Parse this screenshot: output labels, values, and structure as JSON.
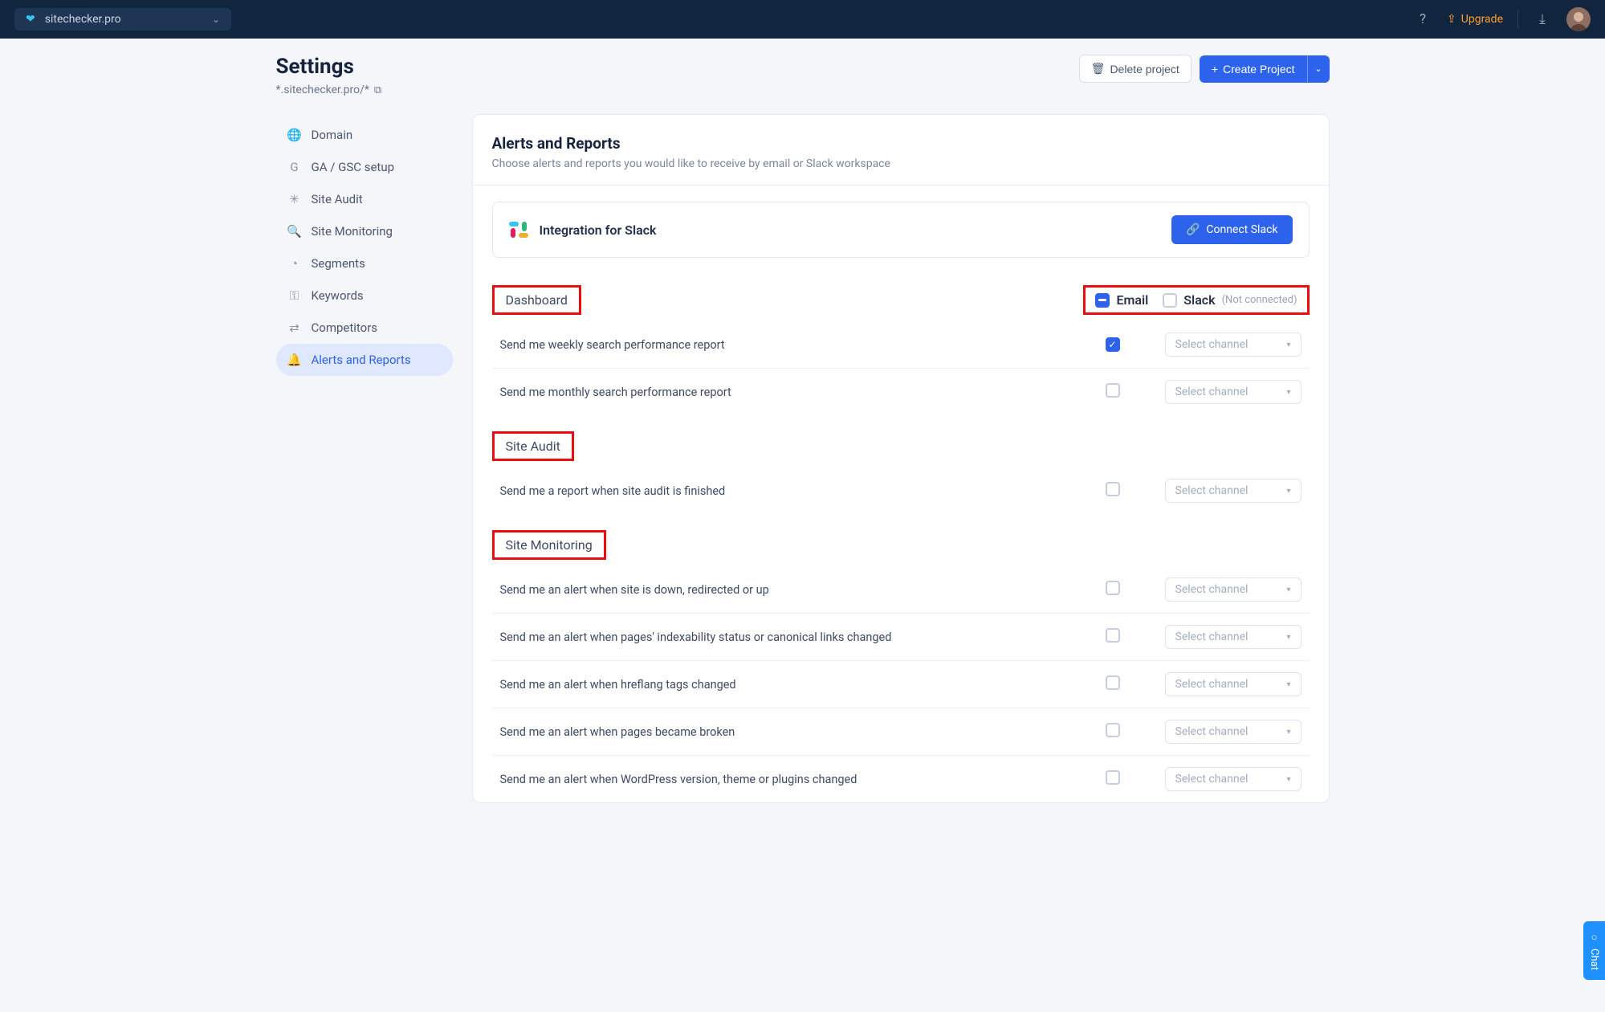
{
  "topbar": {
    "project": "sitechecker.pro",
    "upgrade": "Upgrade"
  },
  "page": {
    "title": "Settings",
    "subtitle": "*.sitechecker.pro/*",
    "delete": "Delete project",
    "create": "Create Project"
  },
  "nav": [
    {
      "icon": "🌐",
      "label": "Domain"
    },
    {
      "icon": "G",
      "label": "GA / GSC setup"
    },
    {
      "icon": "✳",
      "label": "Site Audit"
    },
    {
      "icon": "🔍",
      "label": "Site Monitoring"
    },
    {
      "icon": "◔",
      "label": "Segments"
    },
    {
      "icon": "⚿",
      "label": "Keywords"
    },
    {
      "icon": "⇄",
      "label": "Competitors"
    },
    {
      "icon": "🔔",
      "label": "Alerts and Reports",
      "active": true
    }
  ],
  "content": {
    "title": "Alerts and Reports",
    "desc": "Choose alerts and reports you would like to receive by email or Slack workspace",
    "slack_title": "Integration for Slack",
    "connect": "Connect Slack",
    "email_label": "Email",
    "slack_label": "Slack",
    "slack_status": "(Not connected)",
    "select_placeholder": "Select channel",
    "sections": [
      {
        "title": "Dashboard",
        "rows": [
          {
            "text": "Send me weekly search performance report",
            "email": true
          },
          {
            "text": "Send me monthly search performance report",
            "email": false
          }
        ]
      },
      {
        "title": "Site Audit",
        "rows": [
          {
            "text": "Send me a report when site audit is finished",
            "email": false
          }
        ]
      },
      {
        "title": "Site Monitoring",
        "rows": [
          {
            "text": "Send me an alert when site is down, redirected or up",
            "email": false
          },
          {
            "text": "Send me an alert when pages' indexability status or canonical links changed",
            "email": false
          },
          {
            "text": "Send me an alert when hreflang tags changed",
            "email": false
          },
          {
            "text": "Send me an alert when pages became broken",
            "email": false
          },
          {
            "text": "Send me an alert when WordPress version, theme or plugins changed",
            "email": false
          }
        ]
      }
    ]
  },
  "chat": "Chat"
}
